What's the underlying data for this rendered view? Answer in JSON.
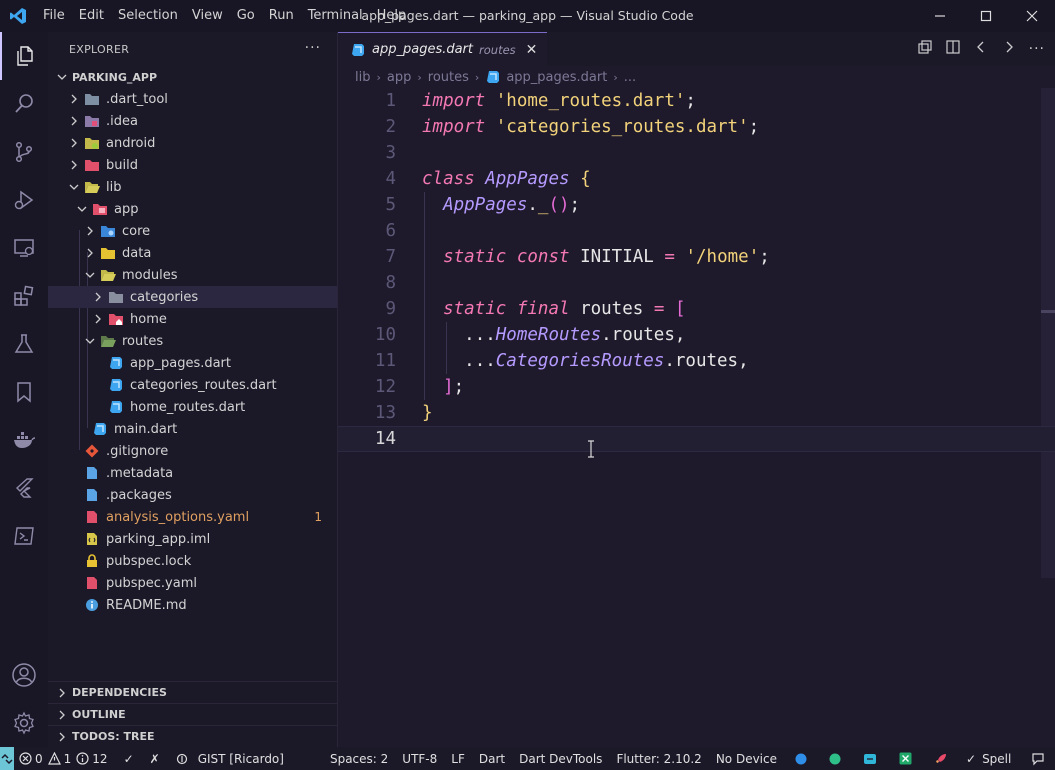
{
  "window": {
    "title": "app_pages.dart — parking_app — Visual Studio Code",
    "menu": [
      "File",
      "Edit",
      "Selection",
      "View",
      "Go",
      "Run",
      "Terminal",
      "Help"
    ]
  },
  "explorer": {
    "header": "EXPLORER",
    "root": "PARKING_APP",
    "items": [
      {
        "label": ".dart_tool"
      },
      {
        "label": ".idea"
      },
      {
        "label": "android"
      },
      {
        "label": "build"
      },
      {
        "label": "lib"
      },
      {
        "label": "app"
      },
      {
        "label": "core"
      },
      {
        "label": "data"
      },
      {
        "label": "modules"
      },
      {
        "label": "categories"
      },
      {
        "label": "home"
      },
      {
        "label": "routes"
      },
      {
        "label": "app_pages.dart"
      },
      {
        "label": "categories_routes.dart"
      },
      {
        "label": "home_routes.dart"
      },
      {
        "label": "main.dart"
      },
      {
        "label": ".gitignore"
      },
      {
        "label": ".metadata"
      },
      {
        "label": ".packages"
      },
      {
        "label": "analysis_options.yaml",
        "badge": "1"
      },
      {
        "label": "parking_app.iml"
      },
      {
        "label": "pubspec.lock"
      },
      {
        "label": "pubspec.yaml"
      },
      {
        "label": "README.md"
      }
    ],
    "sections": [
      "DEPENDENCIES",
      "OUTLINE",
      "TODOS: TREE"
    ]
  },
  "tab": {
    "title": "app_pages.dart",
    "description": "routes"
  },
  "breadcrumb": [
    "lib",
    "app",
    "routes",
    "app_pages.dart",
    "..."
  ],
  "code": {
    "line_numbers": [
      "1",
      "2",
      "3",
      "4",
      "5",
      "6",
      "7",
      "8",
      "9",
      "10",
      "11",
      "12",
      "13",
      "14"
    ],
    "l1": {
      "kw": "import",
      "str": "'home_routes.dart'",
      "end": ";"
    },
    "l2": {
      "kw": "import",
      "str": "'categories_routes.dart'",
      "end": ";"
    },
    "l4": {
      "kw": "class",
      "type": "AppPages",
      "brace": "{"
    },
    "l5": {
      "type": "AppPages",
      "dot": ".",
      "name": "_",
      "paren": "()",
      "end": ";"
    },
    "l7": {
      "kw1": "static",
      "kw2": "const",
      "name": "INITIAL",
      "op": "=",
      "str": "'/home'",
      "end": ";"
    },
    "l9": {
      "kw1": "static",
      "kw2": "final",
      "name": "routes",
      "op": "=",
      "bracket": "["
    },
    "l10": {
      "spread": "...",
      "type": "HomeRoutes",
      "rest": ".routes,"
    },
    "l11": {
      "spread": "...",
      "type": "CategoriesRoutes",
      "rest": ".routes,"
    },
    "l12": {
      "bracket": "]",
      "end": ";"
    },
    "l13": {
      "brace": "}"
    }
  },
  "status": {
    "errors": "0",
    "warnings": "1",
    "infos": "12",
    "gist": "GIST [Ricardo]",
    "spaces": "Spaces: 2",
    "encoding": "UTF-8",
    "eol": "LF",
    "language": "Dart",
    "devtools": "Dart DevTools",
    "flutter": "Flutter: 2.10.2",
    "device": "No Device",
    "spell": "Spell"
  },
  "colors": {
    "keyword": "#f478b4",
    "string": "#f2d27a",
    "type": "#b59aff",
    "remote": "#6cc6d6"
  }
}
